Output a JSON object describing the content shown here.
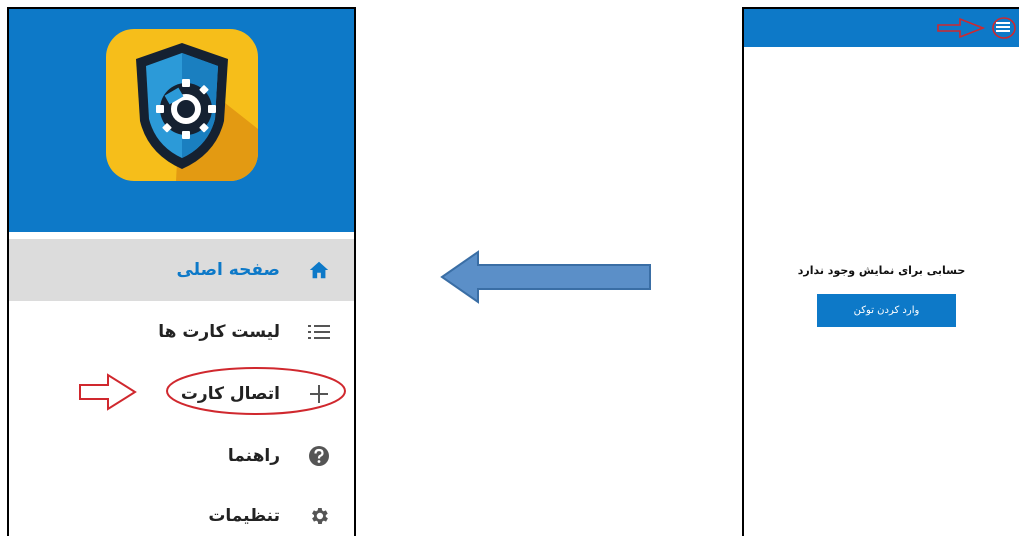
{
  "drawer": {
    "items": [
      {
        "label": "صفحه اصلی",
        "icon": "home-icon",
        "active": true
      },
      {
        "label": "لیست کارت ها",
        "icon": "list-icon",
        "active": false
      },
      {
        "label": "اتصال کارت",
        "icon": "plus-icon",
        "active": false
      },
      {
        "label": "راهنما",
        "icon": "help-icon",
        "active": false
      },
      {
        "label": "تنظیمات",
        "icon": "gear-icon",
        "active": false
      }
    ]
  },
  "main_screen": {
    "empty_message": "حسابی برای نمایش وجود ندارد",
    "token_button": "وارد کردن توکن"
  },
  "colors": {
    "primary": "#0d79c8",
    "annotation": "#d0282e",
    "arrow_fill": "#5b8fc8",
    "arrow_stroke": "#3a6ea5"
  }
}
